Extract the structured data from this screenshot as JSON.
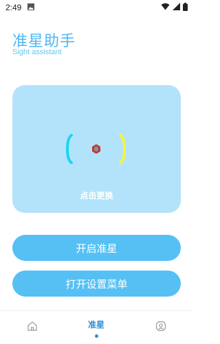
{
  "status": {
    "time": "2:49"
  },
  "header": {
    "title": "准星助手",
    "subtitle": "Sight assistant"
  },
  "preview": {
    "hint": "点击更换"
  },
  "buttons": {
    "start_label": "开启准星",
    "menu_label": "打开设置菜单"
  },
  "nav": {
    "items": [
      {
        "name": "home",
        "label": "",
        "icon": "home-icon"
      },
      {
        "name": "sight",
        "label": "准星",
        "active": true
      },
      {
        "name": "profile",
        "label": "",
        "icon": "profile-icon"
      }
    ]
  },
  "colors": {
    "accent": "#56c0f5",
    "card": "#b3e3fb",
    "title": "#4db7f1",
    "bracket_left": "#18d6f0",
    "bracket_right": "#f4f43a",
    "center_dot": "#c0392b"
  }
}
